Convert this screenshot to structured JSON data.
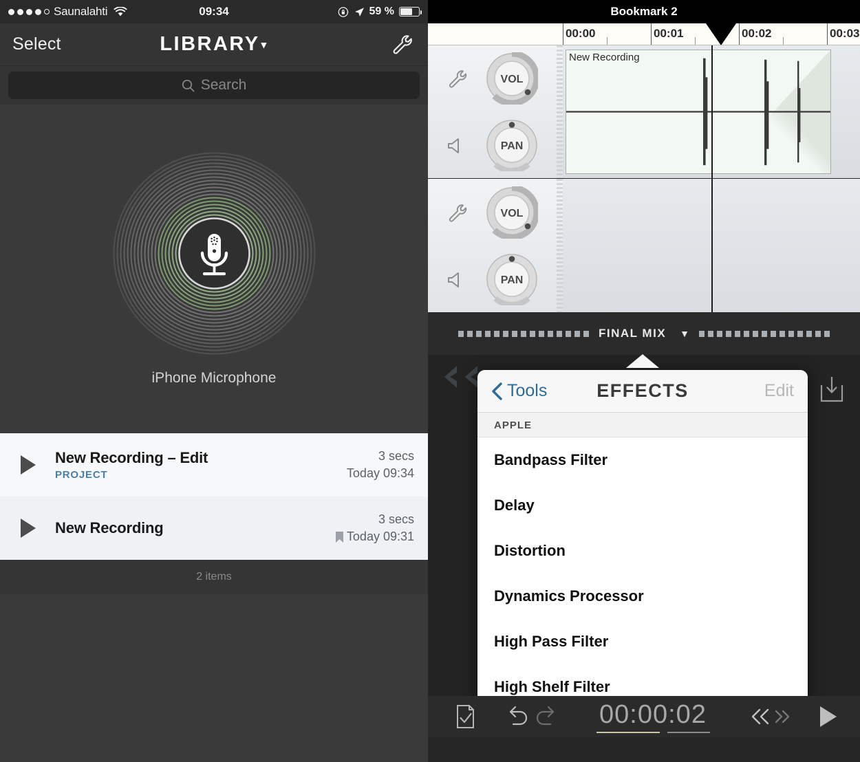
{
  "left_panel": {
    "status_bar": {
      "signal_dots_filled": 4,
      "signal_dots_total": 5,
      "carrier": "Saunalahti",
      "wifi_icon": "wifi-icon",
      "time": "09:34",
      "rotation_lock_icon": "rotation-lock-icon",
      "location_icon": "location-arrow-icon",
      "battery_percent": "59 %",
      "battery_level": 59
    },
    "navbar": {
      "select_label": "Select",
      "title": "LIBRARY",
      "title_caret": "▾",
      "wrench_icon": "wrench-icon"
    },
    "search": {
      "placeholder": "Search",
      "icon": "search-icon"
    },
    "device": {
      "label": "iPhone Microphone",
      "icon": "microphone-icon",
      "ring_accent": "#7d9b6e",
      "ring_outer": "#5d5d5d"
    },
    "recordings": [
      {
        "title": "New Recording – Edit",
        "badge": "PROJECT",
        "duration": "3 secs",
        "date": "Today 09:34",
        "bookmarked": false,
        "play_icon": "play-icon"
      },
      {
        "title": "New Recording",
        "badge": "",
        "duration": "3 secs",
        "date": "Today 09:31",
        "bookmarked": true,
        "play_icon": "play-icon"
      }
    ],
    "footer": "2 items"
  },
  "right_panel": {
    "bookmark_bar": {
      "title": "Bookmark 2",
      "marker_icon": "bookmark-pin-icon"
    },
    "ruler": {
      "labels": [
        "00:00",
        "00:01",
        "00:02",
        "00:03"
      ],
      "playhead_position_label": "00:02"
    },
    "tracks": [
      {
        "vol_label": "VOL",
        "pan_label": "PAN",
        "settings_icon": "wrench-icon",
        "monitor_icon": "speaker-icon",
        "region_name": "New Recording",
        "has_region": true
      },
      {
        "vol_label": "VOL",
        "pan_label": "PAN",
        "settings_icon": "wrench-icon",
        "monitor_icon": "speaker-icon",
        "region_name": "",
        "has_region": false
      }
    ],
    "mix_bar": {
      "label": "FINAL MIX",
      "caret": "▼"
    },
    "export_icon": "download-icon",
    "rewind_chevrons_icon": "double-chevron-left-icon",
    "effects_popover": {
      "back_label": "Tools",
      "back_icon": "chevron-left-icon",
      "title": "EFFECTS",
      "edit_label": "Edit",
      "section_header": "APPLE",
      "items": [
        {
          "label": "Bandpass Filter"
        },
        {
          "label": "Delay"
        },
        {
          "label": "Distortion"
        },
        {
          "label": "Dynamics Processor"
        },
        {
          "label": "High Pass Filter"
        },
        {
          "label": "High Shelf Filter"
        }
      ]
    },
    "toolbar": {
      "document_icon": "document-check-icon",
      "undo_icon": "undo-icon",
      "redo_icon": "redo-icon",
      "timecode": "00:00:02",
      "rewind_icon": "rewind-icon",
      "forward_icon": "forward-icon",
      "play_icon": "play-icon"
    }
  },
  "colors": {
    "accent_green": "#7d9b6e",
    "link_blue": "#2e6b96",
    "project_blue": "#4a7fa8",
    "dark_bg": "#3a3a3a"
  }
}
